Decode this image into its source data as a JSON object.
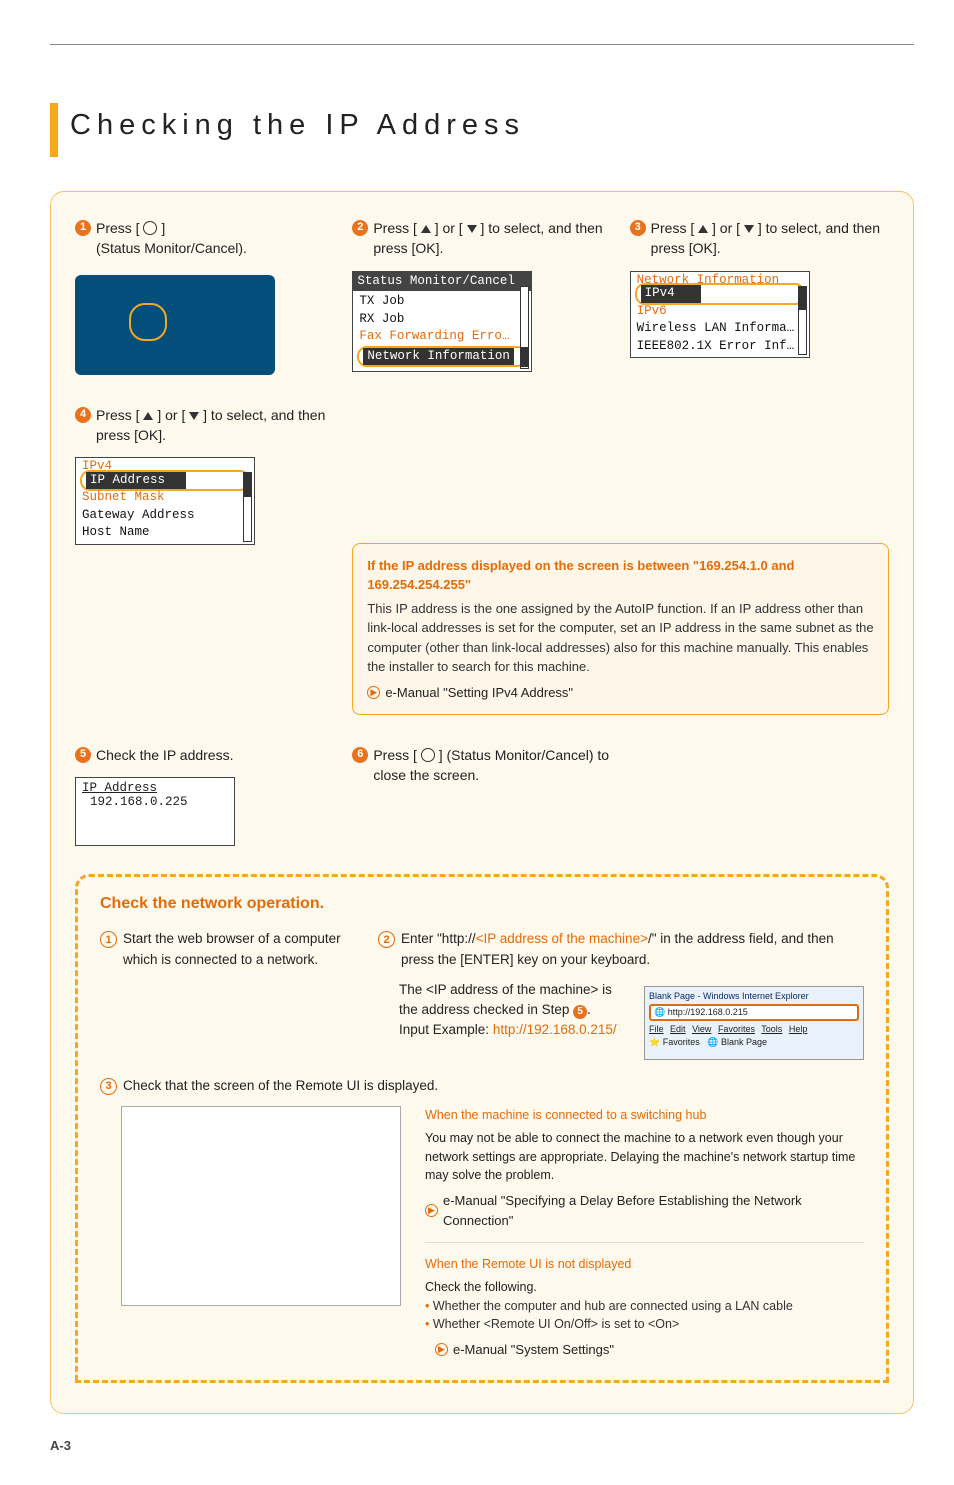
{
  "page_number": "A-3",
  "title": "Checking the IP Address",
  "steps": {
    "s1": {
      "text": "Press [",
      "after": " ]",
      "sub": "(Status Monitor/Cancel)."
    },
    "s2": {
      "text": "Press [",
      "mid": "] or [",
      "after": "] to select, and then press [OK]."
    },
    "s3": {
      "text": "Press [",
      "mid": "] or [",
      "after": "] to select, and then press [OK]."
    },
    "s4": {
      "text": "Press [",
      "mid": "] or [",
      "after": "] to select, and then press [OK]."
    },
    "s5": {
      "text": "Check the IP address."
    },
    "s6": {
      "text": "Press [",
      "after": " ] (Status Monitor/Cancel) to close the screen."
    }
  },
  "lcd2": {
    "title": "Status Monitor/Cancel",
    "rows": [
      "TX Job",
      "RX Job",
      "Fax Forwarding Erro…"
    ],
    "highlight": "Network Information"
  },
  "lcd3": {
    "title": "Network Information",
    "highlight": "IPv4",
    "rows": [
      "IPv6",
      "Wireless LAN Informa…",
      "IEEE802.1X Error Inf…"
    ]
  },
  "lcd4": {
    "title": "IPv4",
    "highlight": "IP Address",
    "rows": [
      "Subnet Mask",
      "Gateway Address",
      "Host Name"
    ]
  },
  "lcd5": {
    "title": "IP Address",
    "value": "192.168.0.225"
  },
  "warning": {
    "title": "If the IP address displayed on the screen is between \"169.254.1.0 and 169.254.254.255\"",
    "body": "This IP address is the one assigned by the AutoIP function. If an IP address other than link-local addresses is set for the computer, set an IP address in the same subnet as the computer (other than link-local addresses) also for this machine manually. This enables the installer to search for this machine.",
    "link": "e-Manual \"Setting IPv4 Address\""
  },
  "network_check": {
    "title": "Check the network operation.",
    "s1": "Start the web browser of a computer which is connected to a network.",
    "s2_a": "Enter \"http://",
    "s2_ip": "<IP address of the machine>",
    "s2_b": "/\" in the address field, and then press the [ENTER] key on your keyboard.",
    "s2_note1": "The <IP address of the machine> is the address checked in Step ",
    "s2_step_ref": "5",
    "s2_note2": ".",
    "s2_example_label": "Input Example: ",
    "s2_example_url": "http://192.168.0.215/",
    "s3": "Check that the screen of the Remote UI is displayed.",
    "browser_title": "Blank Page - Windows Internet Explorer",
    "browser_url": "http://192.168.0.215",
    "browser_menus": [
      "File",
      "Edit",
      "View",
      "Favorites",
      "Tools",
      "Help"
    ],
    "browser_fav": "Favorites",
    "browser_tab": "Blank Page"
  },
  "trouble1": {
    "title": "When the machine is connected to a switching hub",
    "body": "You may not be able to connect the machine to a network even though your network settings are appropriate. Delaying the machine's network startup time may solve the problem.",
    "link": "e-Manual \"Specifying a Delay Before Establishing the Network Connection\""
  },
  "trouble2": {
    "title": "When the Remote UI is not displayed",
    "sub": "Check the following.",
    "b1": "Whether the computer and hub are connected using a LAN cable",
    "b2": "Whether <Remote UI On/Off> is set to <On>",
    "link": "e-Manual \"System Settings\""
  }
}
